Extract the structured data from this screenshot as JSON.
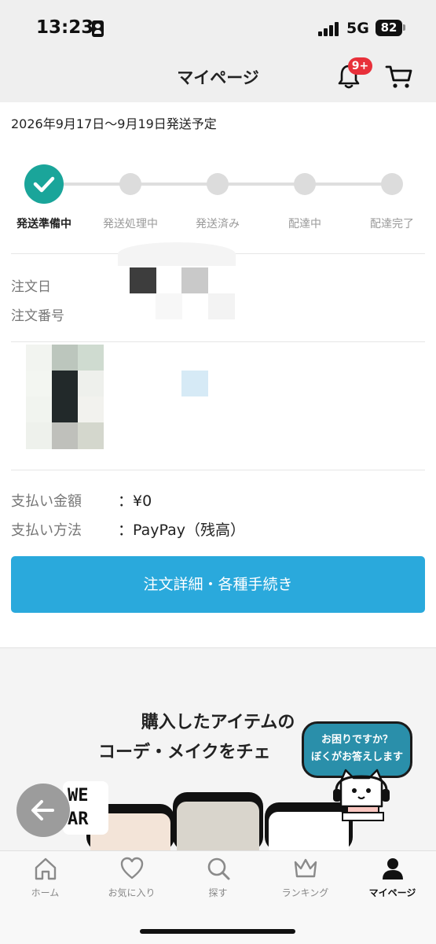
{
  "status_bar": {
    "time": "13:23",
    "network": "5G",
    "battery": "82"
  },
  "header": {
    "title": "マイページ",
    "notification_badge": "9+"
  },
  "order": {
    "ship_date": "2026年9月17日〜9月19日発送予定",
    "steps": [
      {
        "label": "発送準備中",
        "state": "done"
      },
      {
        "label": "発送処理中",
        "state": "pending"
      },
      {
        "label": "発送済み",
        "state": "pending"
      },
      {
        "label": "配達中",
        "state": "pending"
      },
      {
        "label": "配達完了",
        "state": "pending"
      }
    ],
    "order_date_label": "注文日",
    "order_number_label": "注文番号",
    "payment_amount_label": "支払い金額",
    "payment_amount_value": "：¥0",
    "payment_method_label": "支払い方法",
    "payment_method_value": "：PayPay（残高）",
    "detail_button": "注文詳細・各種手続き"
  },
  "promo": {
    "line1": "購入したアイテムの",
    "line2": "コーデ・メイクをチェ",
    "wear_logo": "WE AR"
  },
  "help": {
    "line1": "お困りですか？",
    "line2": "ぼくがお答えします"
  },
  "bottom_nav": [
    {
      "label": "ホーム",
      "icon": "home-icon"
    },
    {
      "label": "お気に入り",
      "icon": "heart-icon"
    },
    {
      "label": "探す",
      "icon": "search-icon"
    },
    {
      "label": "ランキング",
      "icon": "crown-icon"
    },
    {
      "label": "マイページ",
      "icon": "person-icon",
      "active": true
    }
  ],
  "colors": {
    "accent": "#2aa9dc",
    "progress_done": "#1aa59a",
    "badge": "#e8303a"
  }
}
